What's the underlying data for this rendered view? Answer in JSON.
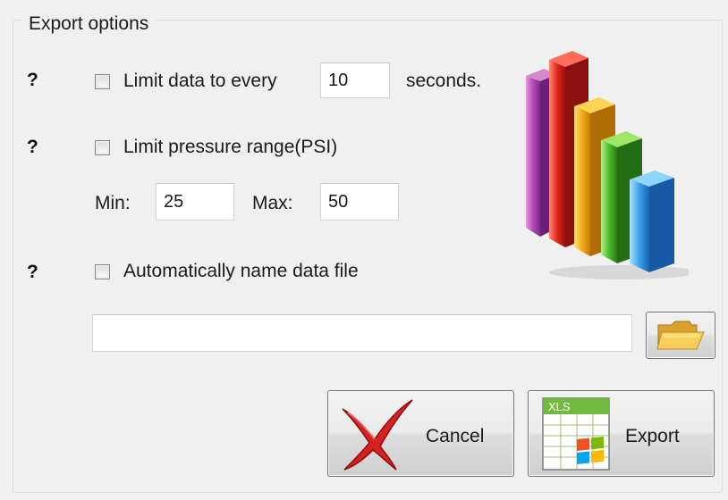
{
  "group": {
    "title": "Export options"
  },
  "help_label": "?",
  "limit_data": {
    "label_before": "Limit data to every",
    "value": "10",
    "label_after": "seconds.",
    "checked": false
  },
  "limit_pressure": {
    "label": "Limit pressure range(PSI)",
    "checked": false,
    "min_label": "Min:",
    "min_value": "25",
    "max_label": "Max:",
    "max_value": "50"
  },
  "auto_name": {
    "label": "Automatically name data file",
    "checked": false
  },
  "file_path": {
    "value": ""
  },
  "buttons": {
    "cancel_label": "Cancel",
    "export_label": "Export",
    "export_icon_text": "XLS"
  },
  "icons": {
    "chart": "bar-chart-icon",
    "browse": "folder-icon",
    "cancel": "red-x-icon",
    "export": "xls-file-icon"
  }
}
